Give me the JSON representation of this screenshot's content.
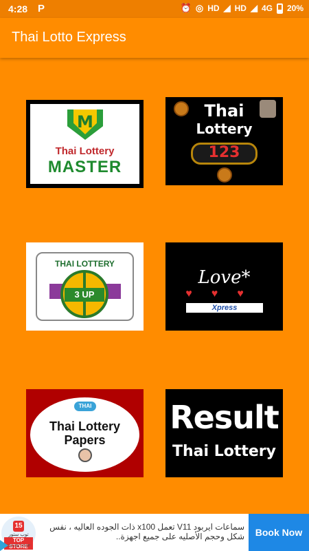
{
  "status_bar": {
    "time": "4:28",
    "p_icon": "P",
    "alarm": "⏰",
    "hotspot": "◎",
    "hd1": "HD",
    "signal1": "◢",
    "hd2": "HD",
    "signal2": "◢",
    "net": "4G",
    "battery": "20%"
  },
  "app_bar": {
    "title": "Thai Lotto Express"
  },
  "tiles": {
    "master": {
      "letter": "M",
      "subtitle": "Thai Lottery",
      "title": "MASTER"
    },
    "lottery123": {
      "title1": "Thai",
      "title2": "Lottery",
      "number": "123"
    },
    "threeup": {
      "title": "THAI LOTTERY",
      "label": "3 UP"
    },
    "love": {
      "title": "Love*",
      "hearts": "♥♥♥",
      "xpress": "Xpress"
    },
    "papers": {
      "badge": "THAI",
      "line1": "Thai Lottery",
      "line2": "Papers"
    },
    "result": {
      "line1": "Result",
      "line2": "Thai Lottery"
    }
  },
  "ad": {
    "logo_num": "15",
    "logo_arabic": "توب ستور",
    "logo_store": "TOP STORE",
    "logo_sub": "ONLINE SHOP",
    "text": "سماعات ايربود V11 تعمل x100 ذات الجوده العاليه ، نفس شكل وحجم الأصليه على جميع اجهزة..",
    "button": "Book Now"
  },
  "colors": {
    "accent": "#FF8C00",
    "status": "#EE7F00",
    "button": "#1E88E5"
  }
}
